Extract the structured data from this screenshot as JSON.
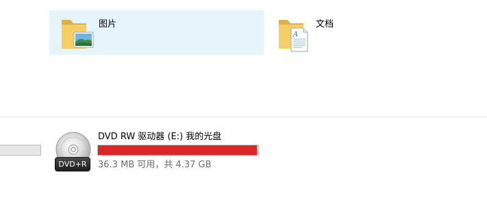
{
  "folders": [
    {
      "label": "图片",
      "icon": "pictures-folder-icon",
      "selected": true
    },
    {
      "label": "文档",
      "icon": "documents-folder-icon",
      "selected": false
    }
  ],
  "drive": {
    "name": "DVD RW 驱动器 (E:) 我的光盘",
    "badge": "DVD+R",
    "free_text": "36.3 MB 可用，共 4.37 GB",
    "used_fraction": 0.992,
    "bar_color": "#da2626",
    "icon": "dvd-disc-icon"
  },
  "colors": {
    "selection_background": "#e5f3fb",
    "bar_critical": "#da2626"
  }
}
